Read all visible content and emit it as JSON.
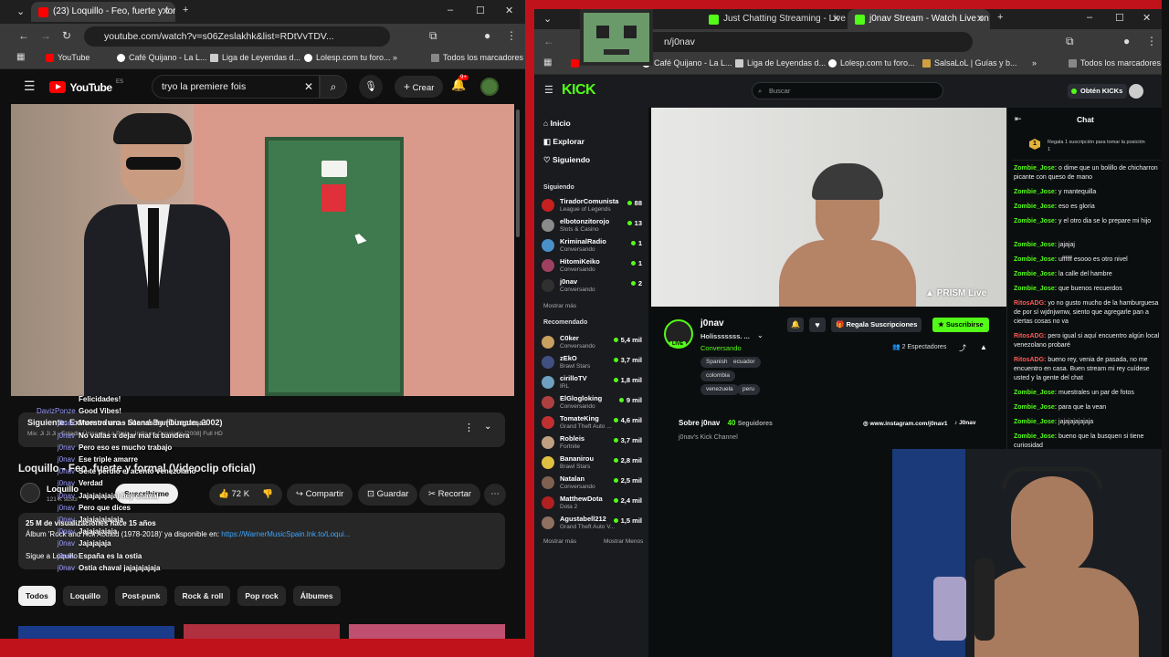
{
  "left_window": {
    "tab": {
      "title": "(23) Loquillo - Feo, fuerte y forma"
    },
    "url": "youtube.com/watch?v=s06Zeslakhk&list=RDtVvTDV...",
    "bookmarks": [
      "YouTube",
      "Café Quijano - La L...",
      "Liga de Leyendas d...",
      "Lolesp.com tu foro..."
    ],
    "bookmarks_more": "»",
    "all_bookmarks": "Todos los marcadores",
    "youtube": {
      "logo": "YouTube",
      "logo_region": "ES",
      "search_query": "tryo la premiere fois",
      "create_label": "Crear",
      "notif_count": "9+",
      "next_label": "Siguiente: Extremoduro - Stand By (Directo, 2002)",
      "mix_label": "Mix: Ji Ji Ji - Estadio Único de La Plata - Indio en Concierto [2008] Full HD",
      "video_title": "Loquillo - Feo, fuerte y formal (Videoclip oficial)",
      "channel": "Loquillo",
      "subscribers": "121 K suscr",
      "subscribe_label": "Suscribirme",
      "likes": "72 K",
      "share_label": "Compartir",
      "save_label": "Guardar",
      "clip_label": "Recortar",
      "desc_line1": "25 M de visualizaciones  hace 15 años",
      "desc_line2_prefix": "Álbum 'Rock and Roll Actitud (1978-2018)' ya disponible en: ",
      "desc_link": "https://WarnerMusicSpain.lnk.to/Loqui...",
      "desc_line3": "Sigue a Loquillo",
      "chips": [
        "Todos",
        "Loquillo",
        "Post-punk",
        "Rock & roll",
        "Pop rock",
        "Álbumes"
      ]
    },
    "chat_overlay": [
      {
        "user": "",
        "text": "Felicidades!"
      },
      {
        "user": "DavizPonze",
        "text": "Good Vibes!"
      },
      {
        "user": "j0nav",
        "text": "Muestra unas buenas hamburguesas"
      },
      {
        "user": "j0nav",
        "text": "No vallas a dejar mal la bandera"
      },
      {
        "user": "j0nav",
        "text": "Pero eso es mucho trabajo"
      },
      {
        "user": "j0nav",
        "text": "Ese triple amarre"
      },
      {
        "user": "j0nav",
        "text": "Se te perdió el acento venezolano"
      },
      {
        "user": "j0nav",
        "text": "Verdad"
      },
      {
        "user": "j0nav",
        "text": "Jajajajajajaj hey chaval"
      },
      {
        "user": "j0nav",
        "text": "Pero que dices"
      },
      {
        "user": "j0nav",
        "text": "Jajajajajajaja"
      },
      {
        "user": "j0nav",
        "text": "Jajajajajaja"
      },
      {
        "user": "j0nav",
        "text": "Jajajajaja"
      },
      {
        "user": "j0nav",
        "text": "España es la ostia"
      },
      {
        "user": "j0nav",
        "text": "Ostia chaval jajajajajaja"
      }
    ]
  },
  "right_window": {
    "tabs": [
      {
        "title": "Just Chatting Streaming - Live S"
      },
      {
        "title": "j0nav Stream - Watch Live on K"
      }
    ],
    "url": "n/j0nav",
    "bookmarks": [
      "YouTube",
      "Café Quijano - La L...",
      "Liga de Leyendas d...",
      "Lolesp.com tu foro...",
      "SalsaLoL | Guías y b..."
    ],
    "bookmarks_more": "»",
    "all_bookmarks": "Todos los marcadores",
    "kick": {
      "logo": "KICK",
      "search_placeholder": "Buscar",
      "get_kicks": "Obtén KICKs",
      "nav": [
        "Inicio",
        "Explorar",
        "Siguiendo"
      ],
      "following_header": "Siguiendo",
      "following": [
        {
          "name": "TiradorComunista",
          "cat": "League of Legends",
          "viewers": "88",
          "color": "#c82020"
        },
        {
          "name": "elbotonzitorojo",
          "cat": "Slots & Casino",
          "viewers": "13",
          "color": "#8a8a8a"
        },
        {
          "name": "KriminalRadio",
          "cat": "Conversando",
          "viewers": "1",
          "color": "#4a90c8"
        },
        {
          "name": "HitomiKeiko",
          "cat": "Conversando",
          "viewers": "1",
          "color": "#a04060"
        },
        {
          "name": "j0nav",
          "cat": "Conversando",
          "viewers": "2",
          "color": "#303030"
        }
      ],
      "show_more": "Mostrar más",
      "recommended_header": "Recomendado",
      "recommended": [
        {
          "name": "C0ker",
          "cat": "Conversando",
          "viewers": "5,4 mil",
          "color": "#c8a060"
        },
        {
          "name": "zEkO",
          "cat": "Brawl Stars",
          "viewers": "3,7 mil",
          "color": "#405080"
        },
        {
          "name": "cirilloTV",
          "cat": "IRL",
          "viewers": "1,8 mil",
          "color": "#70a0c0"
        },
        {
          "name": "ElGlogloking",
          "cat": "Conversando",
          "viewers": "9 mil",
          "color": "#b04040"
        },
        {
          "name": "TomateKing",
          "cat": "Grand Theft Auto ...",
          "viewers": "4,6 mil",
          "color": "#c03030"
        },
        {
          "name": "Robleis",
          "cat": "Fortnite",
          "viewers": "3,7 mil",
          "color": "#c0a080"
        },
        {
          "name": "Bananirou",
          "cat": "Brawl Stars",
          "viewers": "2,8 mil",
          "color": "#e0c040"
        },
        {
          "name": "Natalan",
          "cat": "Conversando",
          "viewers": "2,5 mil",
          "color": "#806050"
        },
        {
          "name": "MatthewDota",
          "cat": "Dota 2",
          "viewers": "2,4 mil",
          "color": "#b02020"
        },
        {
          "name": "Agustabell212",
          "cat": "Grand Theft Auto V...",
          "viewers": "1,5 mil",
          "color": "#907060"
        }
      ],
      "show_more2": "Mostrar más",
      "show_less": "Mostrar Menos",
      "stream_watermark": "PRISM Live",
      "channel": "j0nav",
      "stream_title": "Holisssssss. ...",
      "category": "Conversando",
      "tags": [
        "Spanish",
        "ecuador",
        "colombia",
        "venezuela",
        "peru"
      ],
      "gift_label": "Regala Suscripciones",
      "subscribe_label": "Suscribirse",
      "viewers": "2 Espectadores",
      "about": "Sobre j0nav",
      "followers_count": "40",
      "followers_label": "Seguidores",
      "instagram": "www.instagram.com/j0nav1",
      "tiktok": "J0nav",
      "channel_desc": "j0nav's Kick Channel",
      "chat_title": "Chat",
      "chat_promo": "Regala 1 suscripción para tomar la posición 1",
      "chat_promo_rank": "1",
      "chat": [
        {
          "user": "Zombie_Jose:",
          "text": "o dime que un bolillo de chicharron picante con queso de mano",
          "red": false
        },
        {
          "user": "Zombie_Jose:",
          "text": "y mantequilla",
          "red": false
        },
        {
          "user": "Zombie_Jose:",
          "text": "eso es gloria",
          "red": false
        },
        {
          "user": "Zombie_Jose:",
          "text": "y el otro dia se lo prepare mi hijo",
          "red": false
        },
        {
          "user": "Zombie_Jose:",
          "text": "jajajaj",
          "red": false
        },
        {
          "user": "Zombie_Jose:",
          "text": "uffffff esooo es otro nivel",
          "red": false
        },
        {
          "user": "Zombie_Jose:",
          "text": "la calle del hambre",
          "red": false
        },
        {
          "user": "Zombie_Jose:",
          "text": "que buenos recuerdos",
          "red": false
        },
        {
          "user": "RitosADG:",
          "text": "yo no gusto mucho de la hamburguesa de por sí wjdnjwmw, siento que agregarle pan a ciertas cosas no va",
          "red": true
        },
        {
          "user": "RitosADG:",
          "text": "pero igual si aquí encuentro algún local venezolano probaré",
          "red": true
        },
        {
          "user": "RitosADG:",
          "text": "bueno rey, venia de pasada, no me encuentro en casa. Buen stream mi rey cuídese usted y la gente del chat",
          "red": true
        },
        {
          "user": "Zombie_Jose:",
          "text": "muestrales un par de fotos",
          "red": false
        },
        {
          "user": "Zombie_Jose:",
          "text": "para que la vean",
          "red": false
        },
        {
          "user": "Zombie_Jose:",
          "text": "jajajajajajaja",
          "red": false
        },
        {
          "user": "Zombie_Jose:",
          "text": "bueno que la busquen si tiene curiosidad",
          "red": false
        }
      ]
    }
  },
  "colors": {
    "kick_green": "#53fc18",
    "youtube_red": "#ff0000",
    "background_red": "#c0121a"
  }
}
